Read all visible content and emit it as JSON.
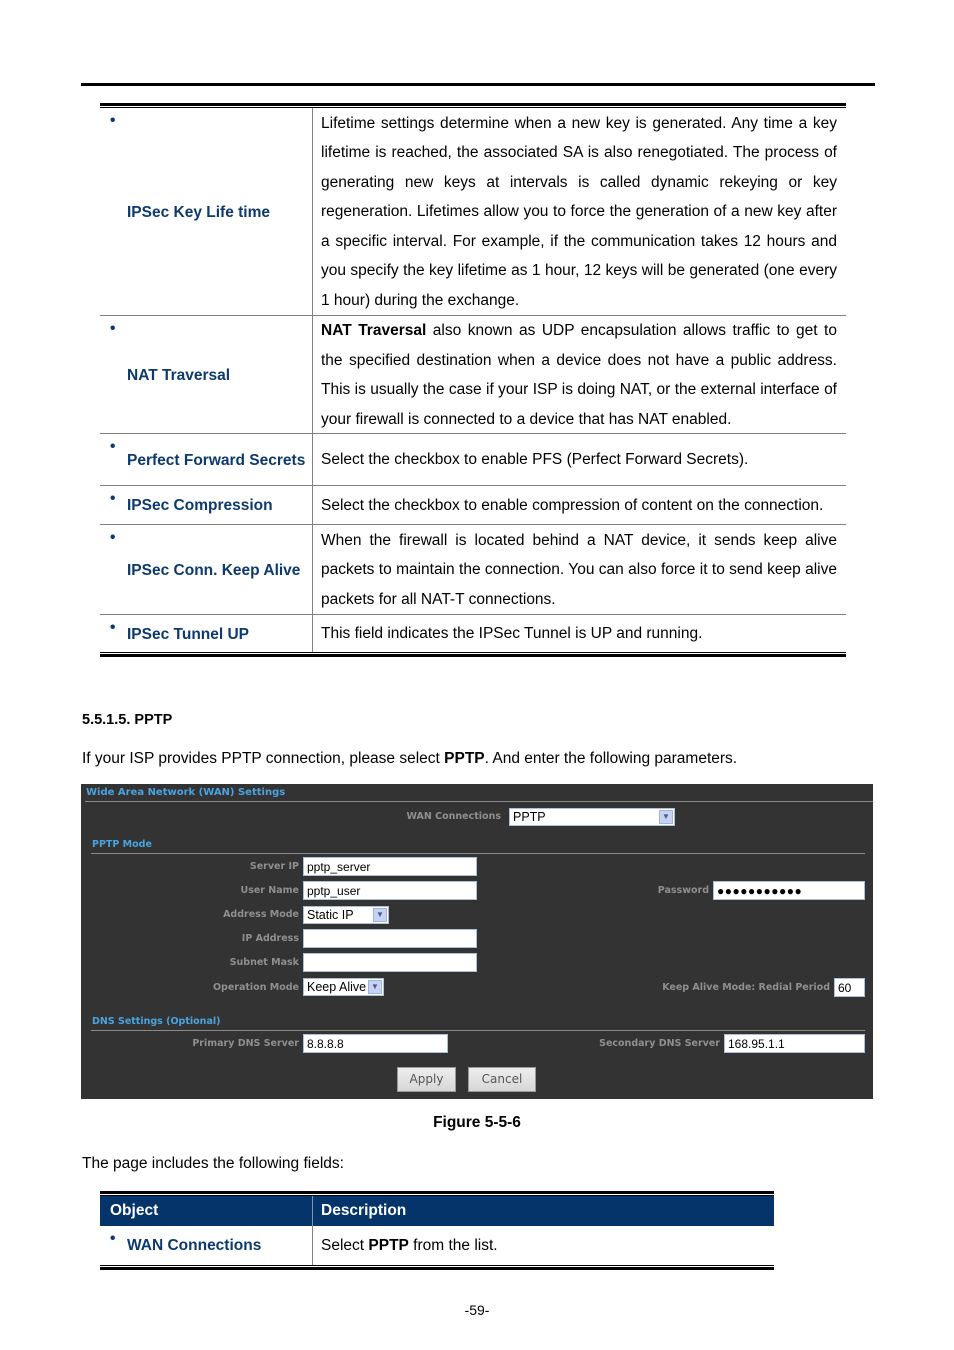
{
  "top_table": {
    "rows": [
      {
        "object": "IPSec Key Life time",
        "description": "Lifetime settings determine when a new key is generated. Any time a key lifetime is reached, the associated SA is also renegotiated. The process of generating new keys at intervals is called dynamic rekeying or key regeneration. Lifetimes allow you to force the generation of a new key after a specific interval. For example, if the communication takes 12 hours and you specify the key lifetime as 1 hour, 12 keys will be generated (one every 1 hour) during the exchange."
      },
      {
        "object": "NAT Traversal",
        "description_bold": "NAT Traversal",
        "description": " also known as UDP encapsulation allows traffic to get to the specified destination when a device does not have a public address. This is usually the case if your ISP is doing NAT, or the external interface of your firewall is connected to a device that has NAT enabled."
      },
      {
        "object": "Perfect Forward Secrets",
        "description": "Select the checkbox to enable PFS (Perfect Forward Secrets)."
      },
      {
        "object": "IPSec Compression",
        "description": "Select the checkbox to enable compression of content on the connection."
      },
      {
        "object": "IPSec Conn. Keep Alive",
        "description": "When the firewall is located behind a NAT device, it sends keep alive packets to maintain the connection. You can also force it to send keep alive packets for all NAT-T connections."
      },
      {
        "object": "IPSec Tunnel UP",
        "description": "This field indicates the IPSec Tunnel is UP and running."
      }
    ]
  },
  "section": {
    "heading": "5.5.1.5.  PPTP",
    "intro_pre": "If your ISP provides PPTP connection, please select ",
    "intro_bold": "PPTP",
    "intro_post": ". And enter the following parameters."
  },
  "wan_panel": {
    "title": "Wide Area Network (WAN) Settings",
    "wan_connections_label": "WAN Connections",
    "wan_connections_value": "PPTP",
    "pptp_mode_title": "PPTP Mode",
    "server_ip_label": "Server IP",
    "server_ip_value": "pptp_server",
    "user_name_label": "User Name",
    "user_name_value": "pptp_user",
    "password_label": "Password",
    "password_value": "●●●●●●●●●●●",
    "address_mode_label": "Address Mode",
    "address_mode_value": "Static IP",
    "ip_address_label": "IP Address",
    "ip_address_value": "",
    "subnet_mask_label": "Subnet Mask",
    "subnet_mask_value": "",
    "operation_mode_label": "Operation Mode",
    "operation_mode_value": "Keep Alive",
    "redial_period_label": "Keep Alive Mode: Redial Period",
    "redial_period_value": "60",
    "dns_title": "DNS Settings (Optional)",
    "primary_dns_label": "Primary DNS Server",
    "primary_dns_value": "8.8.8.8",
    "secondary_dns_label": "Secondary DNS Server",
    "secondary_dns_value": "168.95.1.1",
    "apply_label": "Apply",
    "cancel_label": "Cancel",
    "dropdown_icon": "chevron-down-icon"
  },
  "figure_caption": "Figure 5-5-6",
  "fields_intro": "The page includes the following fields:",
  "bottom_table": {
    "headers": [
      "Object",
      "Description"
    ],
    "rows": [
      {
        "object": "WAN Connections",
        "desc_pre": "Select ",
        "desc_bold": "PPTP",
        "desc_post": " from the list."
      }
    ]
  },
  "page_number": "-59-"
}
